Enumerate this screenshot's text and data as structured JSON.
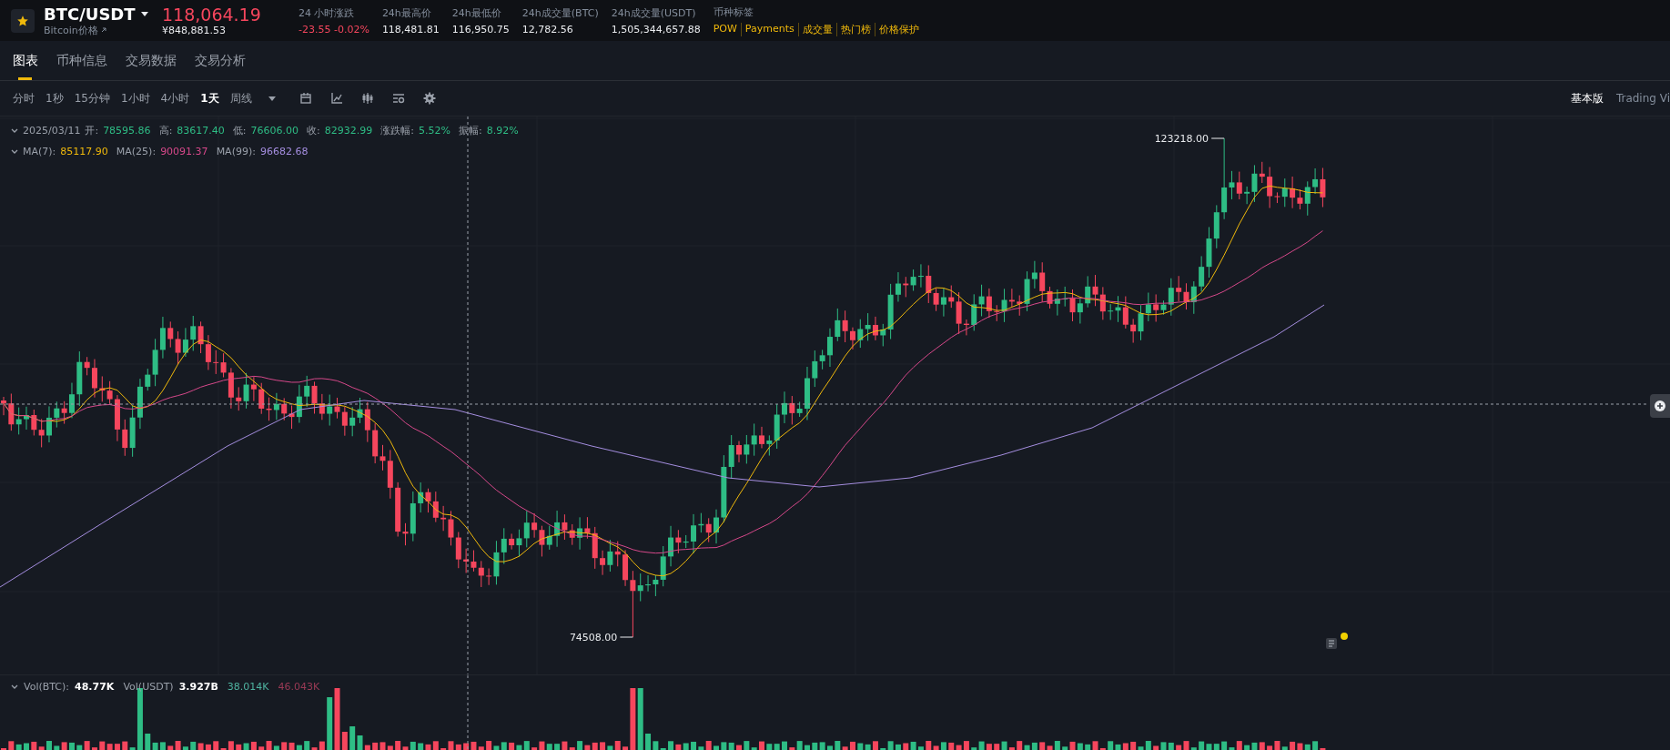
{
  "header": {
    "symbol": "BTC/USDT",
    "subtitle": "Bitcoin价格",
    "price": "118,064.19",
    "price_fiat": "¥848,881.53",
    "stats": [
      {
        "label": "24 小时涨跌",
        "value": "-23.55 -0.02%",
        "kind": "down"
      },
      {
        "label": "24h最高价",
        "value": "118,481.81",
        "kind": "plain"
      },
      {
        "label": "24h最低价",
        "value": "116,950.75",
        "kind": "plain"
      },
      {
        "label": "24h成交量(BTC)",
        "value": "12,782.56",
        "kind": "plain"
      },
      {
        "label": "24h成交量(USDT)",
        "value": "1,505,344,657.88",
        "kind": "plain"
      }
    ],
    "tags_label": "币种标签",
    "tags": [
      "POW",
      "Payments",
      "成交量",
      "热门榜",
      "价格保护"
    ]
  },
  "tabs": [
    {
      "label": "图表",
      "selected": true
    },
    {
      "label": "币种信息",
      "selected": false
    },
    {
      "label": "交易数据",
      "selected": false
    },
    {
      "label": "交易分析",
      "selected": false
    }
  ],
  "intervals": [
    {
      "label": "分时",
      "selected": false
    },
    {
      "label": "1秒",
      "selected": false
    },
    {
      "label": "15分钟",
      "selected": false
    },
    {
      "label": "1小时",
      "selected": false
    },
    {
      "label": "4小时",
      "selected": false
    },
    {
      "label": "1天",
      "selected": true
    },
    {
      "label": "周线",
      "selected": false
    }
  ],
  "view_modes": [
    {
      "label": "基本版",
      "selected": true
    },
    {
      "label": "Trading Vi",
      "selected": false
    }
  ],
  "ohlc": {
    "date": "2025/03/11",
    "fields": [
      {
        "label": "开:",
        "value": "78595.86"
      },
      {
        "label": "高:",
        "value": "83617.40"
      },
      {
        "label": "低:",
        "value": "76606.00"
      },
      {
        "label": "收:",
        "value": "82932.99"
      },
      {
        "label": "涨跌幅:",
        "value": "5.52%"
      },
      {
        "label": "振幅:",
        "value": "8.92%"
      }
    ]
  },
  "moving_averages": [
    {
      "label": "MA(7):",
      "value": "85117.90",
      "color": "#f0b90b"
    },
    {
      "label": "MA(25):",
      "value": "90091.37",
      "color": "#d6488a"
    },
    {
      "label": "MA(99):",
      "value": "96682.68",
      "color": "#a58ee0"
    }
  ],
  "chart_labels": {
    "high": "123218.00",
    "low": "74508.00"
  },
  "volume": {
    "items": [
      {
        "label": "Vol(BTC):",
        "value": "48.77K"
      },
      {
        "label": "Vol(USDT)",
        "value": "3.927B"
      }
    ],
    "extra": [
      {
        "value": "38.014K",
        "color": "#4fb3a0"
      },
      {
        "value": "46.043K",
        "color": "#9a3a55"
      }
    ]
  }
}
